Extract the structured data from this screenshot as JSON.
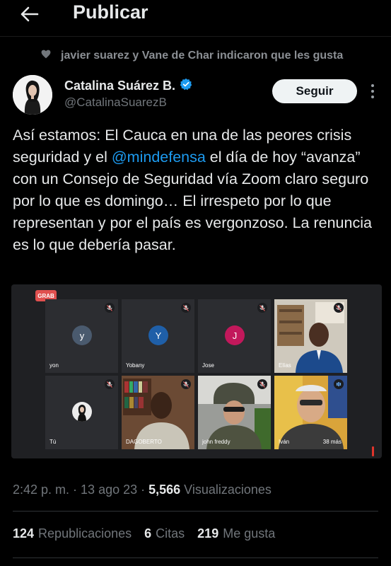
{
  "header": {
    "title": "Publicar"
  },
  "social_context": "javier suarez y Vane de Char indicaron que les gusta",
  "author": {
    "name": "Catalina Suárez B.",
    "handle": "@CatalinaSuarezB",
    "verified": true,
    "follow_label": "Seguir"
  },
  "tweet": {
    "text_before": "Así estamos: El Cauca en una de las peores crisis seguridad y el ",
    "mention": "@mindefensa",
    "text_after": " el día de hoy “avanza” con un Consejo de Seguridad vía Zoom claro seguro por lo que es domingo… El irrespeto por lo que representan y por el país es vergonzoso. La renuncia es lo que debería pasar."
  },
  "media": {
    "rec_label": "GRAB",
    "participants": [
      {
        "name": "yon",
        "initial": "y",
        "color": "#4a5a6e"
      },
      {
        "name": "Yobany",
        "initial": "Y",
        "color": "#1f5fa8"
      },
      {
        "name": "Jose",
        "initial": "J",
        "color": "#c2185b"
      },
      {
        "name": "Elías"
      },
      {
        "name": "Tú"
      },
      {
        "name": "DAGOBERTO"
      },
      {
        "name": "john freddy"
      },
      {
        "name": "Iván"
      }
    ],
    "more_count": "38 más"
  },
  "meta": {
    "time": "2:42 p. m.",
    "date": "13 ago 23",
    "views_count": "5,566",
    "views_label": "Visualizaciones"
  },
  "stats": {
    "reposts_count": "124",
    "reposts_label": "Republicaciones",
    "quotes_count": "6",
    "quotes_label": "Citas",
    "likes_count": "219",
    "likes_label": "Me gusta"
  },
  "colors": {
    "accent": "#1d9bf0",
    "background": "#000000",
    "rec": "#e0504f"
  }
}
